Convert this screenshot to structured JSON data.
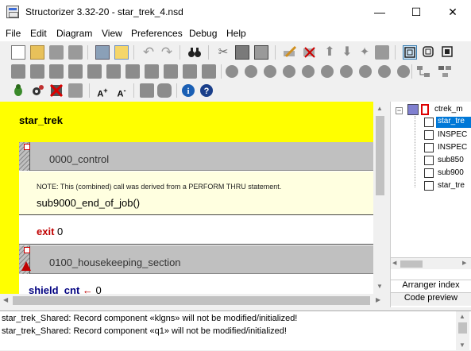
{
  "window": {
    "title": "Structorizer 3.32-20 - star_trek_4.nsd",
    "minimize": "—",
    "maximize": "☐",
    "close": "✕"
  },
  "menu": [
    "File",
    "Edit",
    "Diagram",
    "View",
    "Preferences",
    "Debug",
    "Help"
  ],
  "diagram": {
    "title": "star_trek",
    "call1": "0000_control",
    "note": "NOTE: This (combined) call was derived from a PERFORM THRU statement.",
    "call2": "sub9000_end_of_job()",
    "exit_kw": "exit",
    "exit_val": "0",
    "call3": "0100_housekeeping_section",
    "assign_var": "shield_cnt",
    "assign_arrow": "←",
    "assign_val": "0",
    "colors": {
      "title_bg": "#ffff00",
      "call_bg": "#c0c0c0",
      "note_bg": "#ffffe0",
      "left_bar": "#ffff00"
    }
  },
  "tree": {
    "root": "ctrek_m",
    "items": [
      "star_tre",
      "INSPEC",
      "INSPEC",
      "sub850",
      "sub900",
      "star_tre"
    ]
  },
  "tabs": {
    "arranger": "Arranger index",
    "preview": "Code preview"
  },
  "messages": [
    "star_trek_Shared: Record component «klgns» will not be modified/initialized!",
    "star_trek_Shared: Record component «q1» will not be modified/initialized!"
  ],
  "icons": {
    "binoculars": "binoculars-icon",
    "info": "info-icon",
    "help": "help-icon",
    "scissors": "cut-icon",
    "bug": "bug-icon",
    "gear": "gear-icon",
    "stop": "stop-icon"
  }
}
